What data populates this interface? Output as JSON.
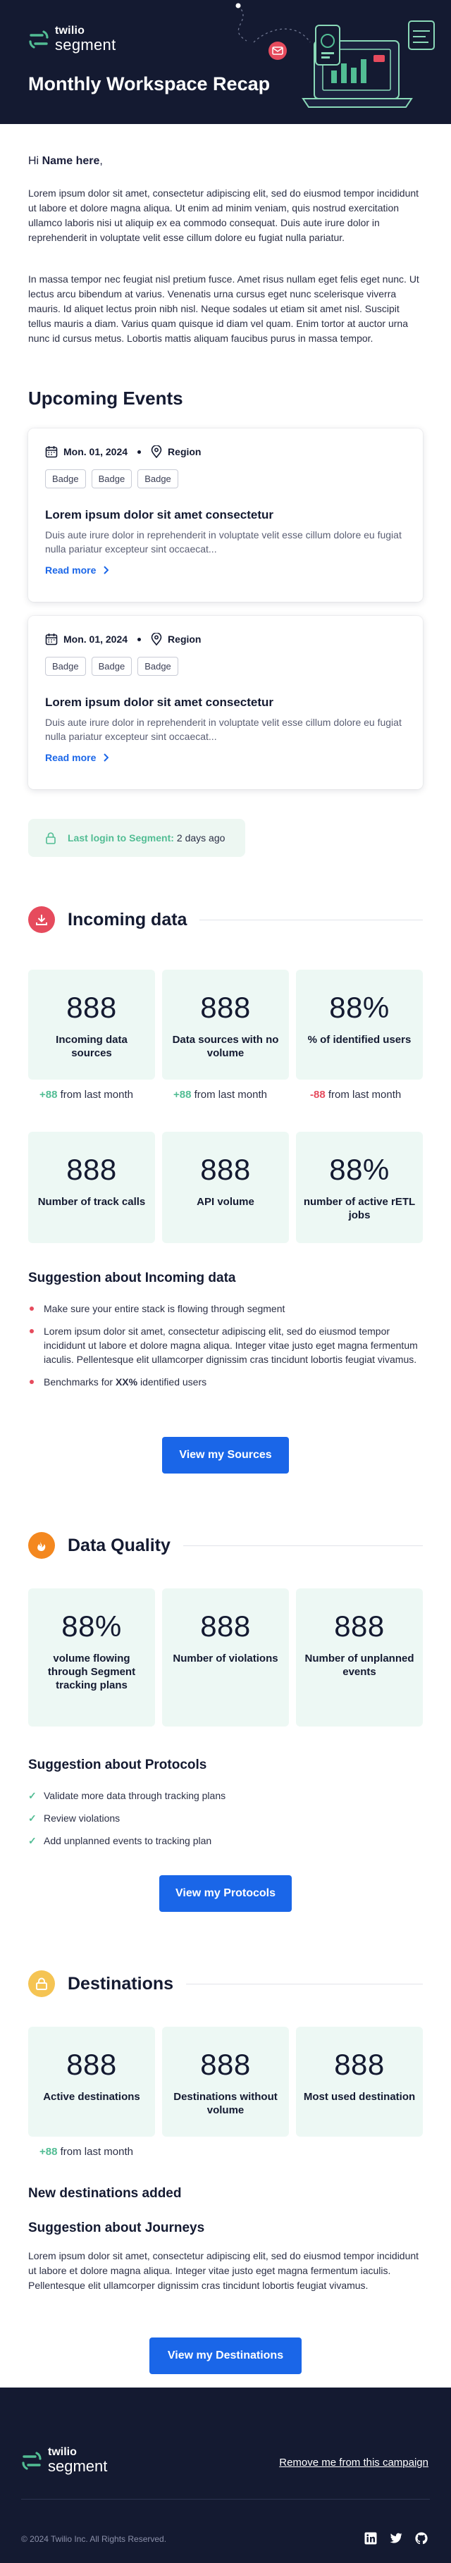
{
  "header": {
    "brand_line1": "twilio",
    "brand_line2": "segment",
    "title": "Monthly Workspace Recap"
  },
  "greeting": {
    "prefix": "Hi ",
    "name": "Name here",
    "suffix": ","
  },
  "intro": {
    "p1": "Lorem ipsum dolor sit amet, consectetur adipiscing elit, sed do eiusmod tempor incididunt ut labore et dolore magna aliqua. Ut enim ad minim veniam, quis nostrud exercitation ullamco laboris nisi ut aliquip ex ea commodo consequat. Duis aute irure dolor in reprehenderit in voluptate velit esse cillum dolore eu fugiat nulla pariatur.",
    "p2": "In massa tempor nec feugiat nisl pretium fusce. Amet risus nullam eget felis eget nunc. Ut lectus arcu bibendum at varius. Venenatis urna cursus eget nunc scelerisque viverra mauris. Id aliquet lectus proin nibh nisl. Neque sodales ut etiam sit amet nisl. Suscipit tellus mauris a diam. Varius quam quisque id diam vel quam. Enim tortor at auctor urna nunc id cursus metus. Lobortis mattis aliquam faucibus purus in massa tempor."
  },
  "events": {
    "heading": "Upcoming Events",
    "items": [
      {
        "date": "Mon. 01, 2024",
        "region": "Region",
        "badges": [
          "Badge",
          "Badge",
          "Badge"
        ],
        "title": "Lorem ipsum dolor sit amet consectetur",
        "desc": "Duis aute irure dolor in reprehenderit in voluptate velit esse cillum dolore eu fugiat nulla pariatur excepteur sint occaecat...",
        "link": "Read more"
      },
      {
        "date": "Mon. 01, 2024",
        "region": "Region",
        "badges": [
          "Badge",
          "Badge",
          "Badge"
        ],
        "title": "Lorem ipsum dolor sit amet consectetur",
        "desc": "Duis aute irure dolor in reprehenderit in voluptate velit esse cillum dolore eu fugiat nulla pariatur excepteur sint occaecat...",
        "link": "Read more"
      }
    ]
  },
  "last_login": {
    "label": "Last login to Segment:",
    "value": "2 days ago"
  },
  "incoming": {
    "title": "Incoming data",
    "stats": [
      {
        "value": "888",
        "label": "Incoming data sources"
      },
      {
        "value": "888",
        "label": "Data sources with no volume"
      },
      {
        "value": "88%",
        "label": "% of identified users"
      },
      {
        "value": "888",
        "label": "Number of track calls"
      },
      {
        "value": "888",
        "label": "API volume"
      },
      {
        "value": "88%",
        "label": "number of active rETL jobs"
      }
    ],
    "deltas": [
      {
        "value": "+88",
        "text": " from last month"
      },
      {
        "value": "+88",
        "text": " from last month"
      },
      {
        "value": "-88",
        "text": "  from last month"
      }
    ],
    "suggestion_title": "Suggestion about Incoming data",
    "suggestions": [
      "Make sure your entire stack is flowing through segment",
      "Lorem ipsum dolor sit amet, consectetur adipiscing elit, sed do eiusmod tempor incididunt ut labore et dolore magna aliqua. Integer vitae justo eget magna fermentum iaculis. Pellentesque elit ullamcorper dignissim cras tincidunt lobortis feugiat vivamus."
    ],
    "benchmark": {
      "prefix": "Benchmarks for ",
      "highlight": "XX%",
      "suffix": " identified users"
    },
    "button": "View my Sources"
  },
  "quality": {
    "title": "Data Quality",
    "stats": [
      {
        "value": "88%",
        "label": "volume flowing through Segment tracking plans"
      },
      {
        "value": "888",
        "label": "Number of violations"
      },
      {
        "value": "888",
        "label": "Number of unplanned events"
      }
    ],
    "suggestion_title": "Suggestion about Protocols",
    "suggestions": [
      "Validate more data through tracking plans",
      "Review violations",
      "Add unplanned events to tracking plan"
    ],
    "button": "View my Protocols"
  },
  "destinations": {
    "title": "Destinations",
    "stats": [
      {
        "value": "888",
        "label": "Active destinations"
      },
      {
        "value": "888",
        "label": "Destinations without volume"
      },
      {
        "value": "888",
        "label": "Most used destination"
      }
    ],
    "delta": {
      "value": "+88",
      "text": " from last month"
    },
    "new_title": "New destinations added",
    "journeys_title": "Suggestion about Journeys",
    "journeys_text": "Lorem ipsum dolor sit amet, consectetur adipiscing elit, sed do eiusmod tempor incididunt ut labore et dolore magna aliqua. Integer vitae justo eget magna fermentum iaculis. Pellentesque elit ullamcorper dignissim cras tincidunt lobortis feugiat vivamus.",
    "button": "View my Destinations"
  },
  "footer": {
    "brand_line1": "twilio",
    "brand_line2": "segment",
    "unsubscribe": "Remove me from this campaign",
    "copyright": "© 2024 Twilio Inc. All Rights Reserved.",
    "social": [
      "linkedin-icon",
      "twitter-icon",
      "github-icon"
    ]
  },
  "colors": {
    "navy": "#141a31",
    "blue": "#1a66e8",
    "green": "#52bd94",
    "red": "#e64b5d",
    "orange": "#f4881f",
    "amber": "#f5c453",
    "tile": "#edf8f4"
  }
}
